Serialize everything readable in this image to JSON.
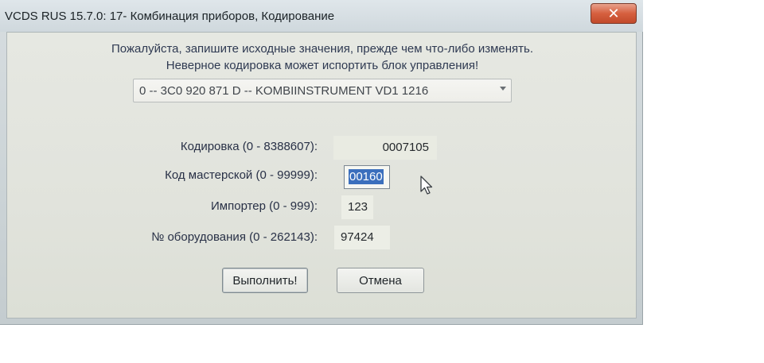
{
  "window": {
    "title": "VCDS RUS 15.7.0: 17- Комбинация приборов,  Кодирование",
    "close_glyph": "✕"
  },
  "warning": {
    "line1": "Пожалуйста, запишите исходные значения, прежде чем что-либо изменять.",
    "line2": "Неверное кодировка может испортить блок управления!"
  },
  "module_select": {
    "selected": "0 -- 3C0 920 871 D -- KOMBIINSTRUMENT VD1 1216"
  },
  "fields": {
    "coding": {
      "label": "Кодировка (0 - 8388607):",
      "value": "0007105"
    },
    "workshop_code": {
      "label": "Код мастерской (0 - 99999):",
      "value": "00160"
    },
    "importer": {
      "label": "Импортер (0 - 999):",
      "value": "123"
    },
    "equipment_no": {
      "label": "№ оборудования (0 - 262143):",
      "value": "97424"
    }
  },
  "buttons": {
    "execute": "Выполнить!",
    "cancel": "Отмена"
  },
  "icons": {
    "close": "close-icon",
    "dropdown": "chevron-down-icon",
    "cursor": "mouse-pointer-icon"
  },
  "colors": {
    "selection": "#3b6fbd",
    "close_button": "#d6603f",
    "text": "#283046"
  }
}
